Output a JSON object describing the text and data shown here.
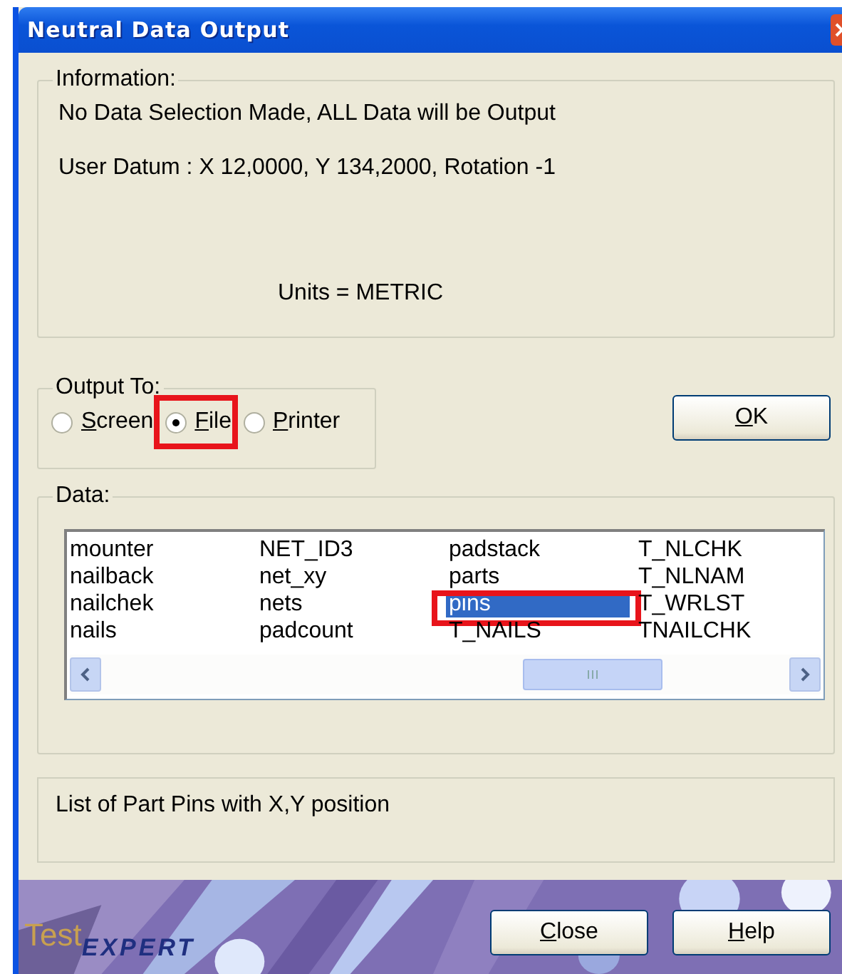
{
  "window": {
    "title": "Neutral Data Output"
  },
  "information": {
    "legend": "Information:",
    "lines": [
      "No Data Selection Made, ALL Data will be Output",
      "User Datum : X 12,0000, Y 134,2000, Rotation -1"
    ],
    "units": "Units = METRIC"
  },
  "output_to": {
    "legend": "Output To:",
    "options": [
      {
        "label": "Screen",
        "selected": false,
        "highlighted": false
      },
      {
        "label": "File",
        "selected": true,
        "highlighted": true
      },
      {
        "label": "Printer",
        "selected": false,
        "highlighted": false
      }
    ]
  },
  "ok_button": "OK",
  "data": {
    "legend": "Data:",
    "items": [
      {
        "label": "mounter",
        "selected": false,
        "highlighted": false
      },
      {
        "label": "nailback",
        "selected": false,
        "highlighted": false
      },
      {
        "label": "nailchek",
        "selected": false,
        "highlighted": false
      },
      {
        "label": "nails",
        "selected": false,
        "highlighted": false
      },
      {
        "label": "NET_ID3",
        "selected": false,
        "highlighted": false
      },
      {
        "label": "net_xy",
        "selected": false,
        "highlighted": false
      },
      {
        "label": "nets",
        "selected": false,
        "highlighted": false
      },
      {
        "label": "padcount",
        "selected": false,
        "highlighted": false
      },
      {
        "label": "padstack",
        "selected": false,
        "highlighted": false
      },
      {
        "label": "parts",
        "selected": false,
        "highlighted": false
      },
      {
        "label": "pins",
        "selected": true,
        "highlighted": true
      },
      {
        "label": "T_NAILS",
        "selected": false,
        "highlighted": false
      },
      {
        "label": "T_NLCHK",
        "selected": false,
        "highlighted": false
      },
      {
        "label": "T_NLNAM",
        "selected": false,
        "highlighted": false
      },
      {
        "label": "T_WRLST",
        "selected": false,
        "highlighted": false
      },
      {
        "label": "TNAILCHK",
        "selected": false,
        "highlighted": false
      }
    ]
  },
  "description": "List of Part Pins with X,Y position",
  "logo": {
    "part_1": "Test",
    "part_2": "EXPERT"
  },
  "buttons": [
    "Close",
    "Help"
  ]
}
